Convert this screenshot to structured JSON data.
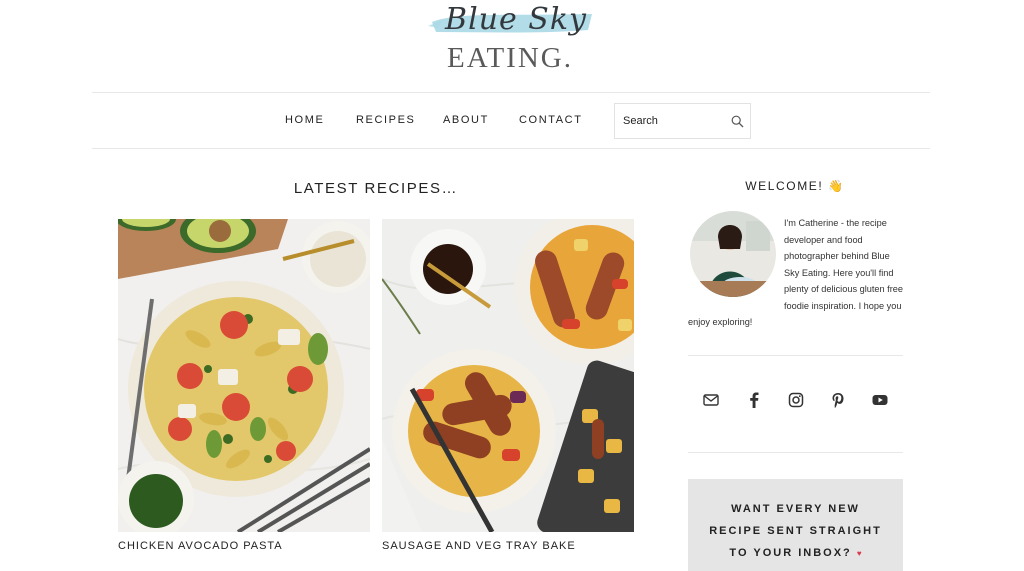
{
  "logo": {
    "script": "Blue Sky",
    "word": "EATING."
  },
  "nav": {
    "items": [
      {
        "label": "HOME"
      },
      {
        "label": "RECIPES"
      },
      {
        "label": "ABOUT"
      },
      {
        "label": "CONTACT"
      }
    ]
  },
  "search": {
    "placeholder": "Search"
  },
  "latest": {
    "title": "LATEST RECIPES…",
    "recipes": [
      {
        "title": "CHICKEN AVOCADO PASTA"
      },
      {
        "title": "SAUSAGE AND VEG TRAY BAKE"
      }
    ]
  },
  "sidebar": {
    "welcome_title": "WELCOME!",
    "welcome_emoji": "👋",
    "bio": "I'm Catherine - the recipe developer and food photographer behind Blue Sky Eating. Here you'll find plenty of delicious gluten free foodie inspiration. I hope you enjoy exploring!",
    "social": [
      {
        "icon": "envelope-icon"
      },
      {
        "icon": "facebook-icon"
      },
      {
        "icon": "instagram-icon"
      },
      {
        "icon": "pinterest-icon"
      },
      {
        "icon": "youtube-icon"
      }
    ],
    "newsletter": {
      "line1": "WANT EVERY NEW",
      "line2": "RECIPE SENT STRAIGHT",
      "line3": "TO YOUR INBOX?",
      "heart": "♥"
    }
  },
  "colors": {
    "brush": "#a9d8e6",
    "newsletter_bg": "#e5e5e5",
    "text": "#222222"
  }
}
